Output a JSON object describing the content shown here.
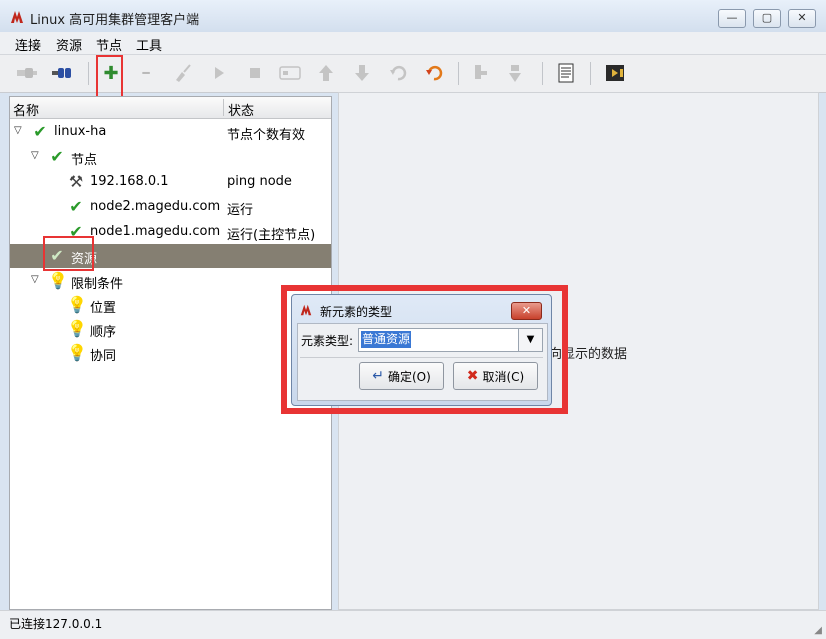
{
  "window": {
    "title": "Linux 高可用集群管理客户端",
    "minimize": "—",
    "maximize": "▢",
    "close": "✕"
  },
  "menu": [
    "连接",
    "资源",
    "节点",
    "工具"
  ],
  "toolbar": {
    "add_symbol": "✚",
    "remove_symbol": "━"
  },
  "tree": {
    "col_name": "名称",
    "col_status": "状态",
    "rows": [
      {
        "label": "linux-ha",
        "status": "节点个数有效"
      },
      {
        "label": "节点",
        "status": ""
      },
      {
        "label": "192.168.0.1",
        "status": "ping node"
      },
      {
        "label": "node2.magedu.com",
        "status": "运行"
      },
      {
        "label": "node1.magedu.com",
        "status": "运行(主控节点)"
      },
      {
        "label": "资源",
        "status": ""
      },
      {
        "label": "限制条件",
        "status": ""
      },
      {
        "label": "位置",
        "status": ""
      },
      {
        "label": "顺序",
        "status": ""
      },
      {
        "label": "协同",
        "status": ""
      }
    ]
  },
  "right_pane": {
    "hint": "向显示的数据"
  },
  "status_bar": {
    "text": "已连接127.0.0.1"
  },
  "dialog": {
    "title": "新元素的类型",
    "label": "元素类型:",
    "value": "普通资源",
    "ok": "确定(O)",
    "cancel": "取消(C)"
  },
  "colors": {
    "highlight": "#e83434",
    "selection": "#857f72",
    "check": "#2a9a2a"
  }
}
